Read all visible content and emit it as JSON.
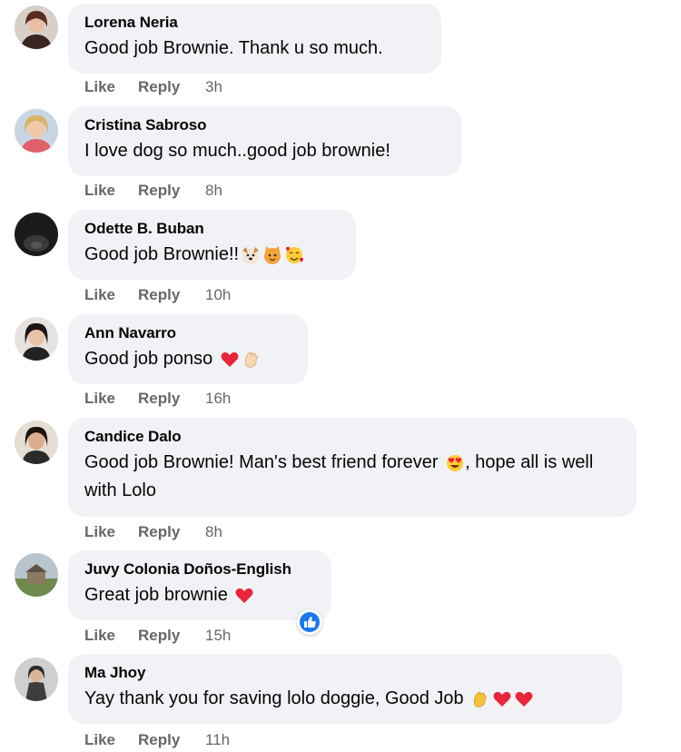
{
  "comments": [
    {
      "author": "Lorena Neria",
      "text": "Good job Brownie. Thank u so much.",
      "emojis": [],
      "like": "Like",
      "reply": "Reply",
      "time": "3h"
    },
    {
      "author": "Cristina Sabroso",
      "text": "I love dog so much..good job brownie!",
      "emojis": [],
      "like": "Like",
      "reply": "Reply",
      "time": "8h"
    },
    {
      "author": "Odette B. Buban",
      "text": "Good job Brownie!!",
      "emojis": [
        "dog-face",
        "cat-face",
        "smiling-face-with-hearts"
      ],
      "like": "Like",
      "reply": "Reply",
      "time": "10h"
    },
    {
      "author": "Ann Navarro",
      "text": "Good job ponso",
      "emojis": [
        "red-heart",
        "clapping-hands"
      ],
      "like": "Like",
      "reply": "Reply",
      "time": "16h"
    },
    {
      "author": "Candice Dalo",
      "text_before": "Good job Brownie! Man's best friend forever",
      "text_after": ", hope all is well with Lolo",
      "emojis": [
        "heart-eyes"
      ],
      "like": "Like",
      "reply": "Reply",
      "time": "8h"
    },
    {
      "author": "Juvy Colonia Doños-English",
      "text": "Great job brownie",
      "emojis": [
        "red-heart"
      ],
      "like": "Like",
      "reply": "Reply",
      "time": "15h",
      "reaction": "like-reaction-icon"
    },
    {
      "author": "Ma Jhoy",
      "text": "Yay thank you for saving lolo doggie, Good Job",
      "emojis": [
        "clapping-hands",
        "red-heart",
        "red-heart"
      ],
      "like": "Like",
      "reply": "Reply",
      "time": "11h"
    }
  ],
  "colors": {
    "bubble": "#f0f2f5",
    "meta": "#65676b",
    "text": "#050505",
    "facebook_blue": "#1877f2"
  }
}
